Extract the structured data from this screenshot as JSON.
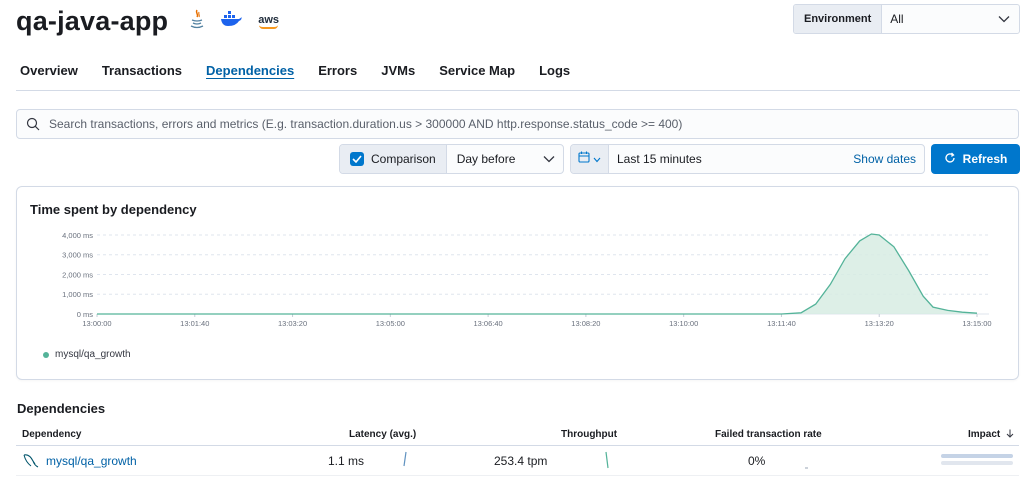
{
  "header": {
    "app_title": "qa-java-app",
    "agent_icons": [
      "java-icon",
      "docker-icon",
      "aws-icon"
    ],
    "aws_text": "aws"
  },
  "environment": {
    "label": "Environment",
    "value": "All"
  },
  "tabs": [
    {
      "label": "Overview",
      "active": false
    },
    {
      "label": "Transactions",
      "active": false
    },
    {
      "label": "Dependencies",
      "active": true
    },
    {
      "label": "Errors",
      "active": false
    },
    {
      "label": "JVMs",
      "active": false
    },
    {
      "label": "Service Map",
      "active": false
    },
    {
      "label": "Logs",
      "active": false
    }
  ],
  "search": {
    "placeholder": "Search transactions, errors and metrics (E.g. transaction.duration.us > 300000 AND http.response.status_code >= 400)",
    "value": ""
  },
  "comparison": {
    "label": "Comparison",
    "checked": true,
    "value": "Day before"
  },
  "date_picker": {
    "value": "Last 15 minutes",
    "show_dates": "Show dates"
  },
  "refresh": {
    "label": "Refresh"
  },
  "colors": {
    "accent": "#0077cc",
    "link": "#0061a6",
    "series": "#54b399",
    "series_fill": "#d7ece3"
  },
  "chart_panel": {
    "title": "Time spent by dependency"
  },
  "chart_data": {
    "type": "area",
    "title": "Time spent by dependency",
    "xlabel": "",
    "ylabel": "",
    "x_ticks": [
      "13:00:00",
      "13:01:40",
      "13:03:20",
      "13:05:00",
      "13:06:40",
      "13:08:20",
      "13:10:00",
      "13:11:40",
      "13:13:20",
      "13:15:00"
    ],
    "y_ticks": [
      "0 ms",
      "1,000 ms",
      "2,000 ms",
      "3,000 ms",
      "4,000 ms"
    ],
    "ylim": [
      0,
      4200
    ],
    "xlim_seconds_range": [
      0,
      900
    ],
    "grid": true,
    "legend": "bottom-left",
    "series": [
      {
        "name": "mysql/qa_growth",
        "points": [
          [
            0,
            0
          ],
          [
            60,
            0
          ],
          [
            120,
            0
          ],
          [
            180,
            0
          ],
          [
            240,
            0
          ],
          [
            300,
            0
          ],
          [
            360,
            0
          ],
          [
            420,
            0
          ],
          [
            480,
            0
          ],
          [
            540,
            0
          ],
          [
            600,
            0
          ],
          [
            660,
            0
          ],
          [
            690,
            0
          ],
          [
            700,
            0
          ],
          [
            720,
            60
          ],
          [
            735,
            500
          ],
          [
            750,
            1500
          ],
          [
            765,
            2800
          ],
          [
            780,
            3700
          ],
          [
            792,
            4050
          ],
          [
            800,
            4000
          ],
          [
            815,
            3400
          ],
          [
            830,
            2200
          ],
          [
            845,
            900
          ],
          [
            855,
            350
          ],
          [
            870,
            180
          ],
          [
            885,
            90
          ],
          [
            900,
            40
          ]
        ]
      }
    ]
  },
  "dependencies": {
    "title": "Dependencies",
    "columns": [
      "Dependency",
      "Latency (avg.)",
      "Throughput",
      "Failed transaction rate",
      "Impact"
    ],
    "rows": [
      {
        "name": "mysql/qa_growth",
        "latency": "1.1 ms",
        "throughput": "253.4 tpm",
        "failed_rate": "0%",
        "impact": 1.0
      }
    ]
  }
}
